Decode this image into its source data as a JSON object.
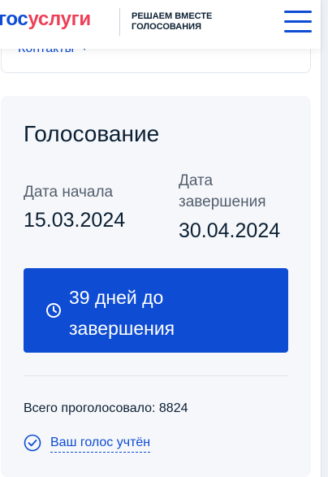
{
  "header": {
    "logo_part1": "гос",
    "logo_part2": "услуги",
    "tagline": "Решаем вместе голосования",
    "menu_icon": "burger-menu-icon"
  },
  "contacts": {
    "label": "Контакты",
    "chevron_icon": "chevron-down-icon"
  },
  "voting": {
    "title": "Голосование",
    "start_label": "Дата начала",
    "start_value": "15.03.2024",
    "end_label": "Дата завершения",
    "end_value": "30.04.2024",
    "countdown_icon": "clock-icon",
    "countdown_text": "39 дней до завершения",
    "total_text": "Всего проголосовало: 8824",
    "status_icon": "check-circle-icon",
    "status_text": "Ваш голос учтён"
  },
  "colors": {
    "brand_blue": "#0d4cd3",
    "brand_red": "#ee3f58",
    "card_bg": "#f5f7fa",
    "text_primary": "#0b1f33",
    "text_secondary": "#535f6e"
  }
}
